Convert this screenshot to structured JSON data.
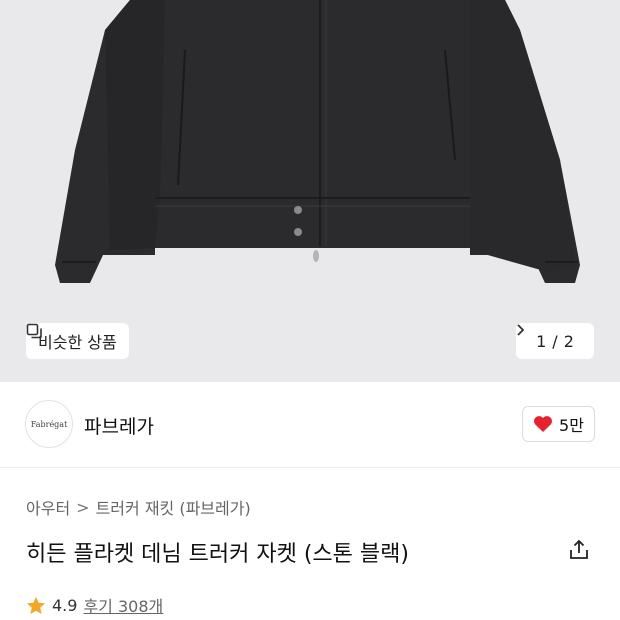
{
  "product_image": {
    "similar_label": "비슷한 상품",
    "pager": {
      "current": "1",
      "separator": "/",
      "total": "2"
    }
  },
  "brand": {
    "logo_text": "Fabrégat",
    "name": "파브레가",
    "like_count": "5만"
  },
  "breadcrumb": {
    "items": [
      "아우터",
      "트러커 재킷 (파브레가)"
    ],
    "separator": ">"
  },
  "product": {
    "title": "히든 플라켓 데님 트러커 자켓 (스톤 블랙)",
    "rating": "4.9",
    "review_label": "후기 308개"
  },
  "colors": {
    "hero_bg": "#e9e9eb",
    "jacket": "#2b2b2d",
    "heart": "#e8212e",
    "star": "#f5a623"
  },
  "icons": {
    "similar": "copy-icon",
    "pager_next": "chevron-right-icon",
    "like": "heart-icon",
    "share": "share-icon",
    "rating": "star-icon"
  }
}
